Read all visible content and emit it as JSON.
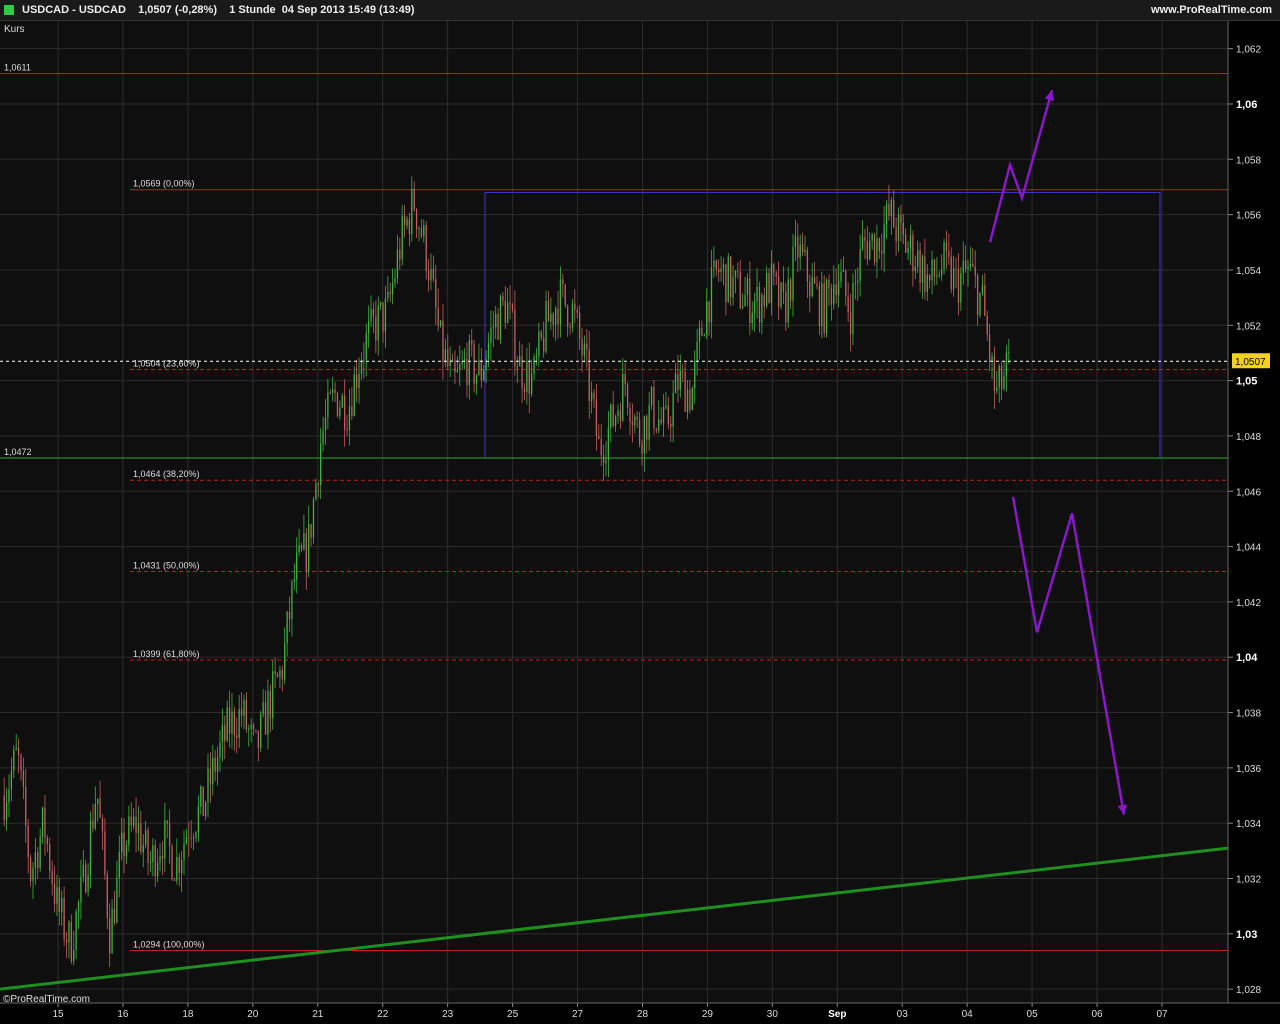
{
  "header": {
    "title": "USDCAD - USDCAD    1,0507 (-0,28%)    1 Stunde  04 Sep 2013 15:49 (13:49)",
    "brand": "www.ProRealTime.com"
  },
  "panel_label": "Kurs",
  "copyright": "©ProRealTime.com",
  "colors": {
    "background": "#0f0f0f",
    "grid": "#2c2c2c",
    "bull": "#3fb43f",
    "bear": "#c06060",
    "resistance": "#c81e1e",
    "fib": "#c81e1e",
    "support": "#2fa82f",
    "trend": "#1f8f1f",
    "box": "#3838c8",
    "arrows": "#8a17c8",
    "price_tag": "#f2d21c"
  },
  "chart_data": {
    "type": "candlestick",
    "instrument": "USDCAD",
    "ylim": [
      1.0275,
      1.063
    ],
    "yticks": [
      {
        "value": 1.028,
        "label": "1,028",
        "major": false
      },
      {
        "value": 1.03,
        "label": "1,03",
        "major": true
      },
      {
        "value": 1.032,
        "label": "1,032",
        "major": false
      },
      {
        "value": 1.034,
        "label": "1,034",
        "major": false
      },
      {
        "value": 1.036,
        "label": "1,036",
        "major": false
      },
      {
        "value": 1.038,
        "label": "1,038",
        "major": false
      },
      {
        "value": 1.04,
        "label": "1,04",
        "major": true
      },
      {
        "value": 1.042,
        "label": "1,042",
        "major": false
      },
      {
        "value": 1.044,
        "label": "1,044",
        "major": false
      },
      {
        "value": 1.046,
        "label": "1,046",
        "major": false
      },
      {
        "value": 1.048,
        "label": "1,048",
        "major": false
      },
      {
        "value": 1.05,
        "label": "1,05",
        "major": true
      },
      {
        "value": 1.052,
        "label": "1,052",
        "major": false
      },
      {
        "value": 1.054,
        "label": "1,054",
        "major": false
      },
      {
        "value": 1.056,
        "label": "1,056",
        "major": false
      },
      {
        "value": 1.058,
        "label": "1,058",
        "major": false
      },
      {
        "value": 1.06,
        "label": "1,06",
        "major": true
      },
      {
        "value": 1.062,
        "label": "1,062",
        "major": false
      }
    ],
    "xticks": [
      {
        "label": "15",
        "major": false
      },
      {
        "label": "16",
        "major": false
      },
      {
        "label": "18",
        "major": false
      },
      {
        "label": "20",
        "major": false
      },
      {
        "label": "21",
        "major": false
      },
      {
        "label": "22",
        "major": false
      },
      {
        "label": "23",
        "major": false
      },
      {
        "label": "25",
        "major": false
      },
      {
        "label": "27",
        "major": false
      },
      {
        "label": "28",
        "major": false
      },
      {
        "label": "29",
        "major": false
      },
      {
        "label": "30",
        "major": false
      },
      {
        "label": "Sep",
        "major": true
      },
      {
        "label": "03",
        "major": false
      },
      {
        "label": "04",
        "major": false
      },
      {
        "label": "05",
        "major": false
      },
      {
        "label": "06",
        "major": false
      },
      {
        "label": "07",
        "major": false
      }
    ],
    "close_path": [
      1.035,
      1.0365,
      1.0322,
      1.034,
      1.031,
      1.0296,
      1.0318,
      1.0353,
      1.03,
      1.0332,
      1.034,
      1.0325,
      1.0335,
      1.0325,
      1.034,
      1.0345,
      1.0362,
      1.0375,
      1.038,
      1.0365,
      1.0383,
      1.0395,
      1.043,
      1.044,
      1.048,
      1.0495,
      1.049,
      1.051,
      1.052,
      1.0525,
      1.055,
      1.0565,
      1.0545,
      1.0513,
      1.0498,
      1.0507,
      1.0502,
      1.052,
      1.0528,
      1.0505,
      1.05,
      1.052,
      1.053,
      1.0525,
      1.0505,
      1.0475,
      1.0485,
      1.05,
      1.048,
      1.049,
      1.0482,
      1.05,
      1.0495,
      1.0525,
      1.054,
      1.0535,
      1.053,
      1.0528,
      1.0535,
      1.0525,
      1.0548,
      1.0535,
      1.0525,
      1.054,
      1.0525,
      1.055,
      1.055,
      1.056,
      1.055,
      1.0545,
      1.0535,
      1.0542,
      1.0535,
      1.054,
      1.0528,
      1.0494,
      1.0505
    ],
    "levels": [
      {
        "value": 1.0611,
        "label": "1,0611",
        "style": "resistance"
      },
      {
        "value": 1.0569,
        "label": "1,0569 (0,00%)",
        "style": "resistance"
      },
      {
        "value": 1.0504,
        "label": "1,0504 (23,60%)",
        "style": "fib"
      },
      {
        "value": 1.0472,
        "label": "1,0472",
        "style": "support"
      },
      {
        "value": 1.0464,
        "label": "1,0464 (38,20%)",
        "style": "fib"
      },
      {
        "value": 1.0431,
        "label": "1,0431 (50,00%)",
        "style": "fib"
      },
      {
        "value": 1.0399,
        "label": "1,0399 (61,80%)",
        "style": "fib"
      },
      {
        "value": 1.0294,
        "label": "1,0294 (100,00%)",
        "style": "resistance"
      }
    ],
    "current_price": {
      "value": 1.0507,
      "label": "1,0507"
    },
    "consolidation_box": {
      "ymin": 1.0472,
      "ymax": 1.0568
    },
    "trendline": {
      "y_start": 1.028,
      "y_end": 1.0331
    },
    "scenarios": [
      {
        "name": "upside",
        "path": [
          1.055,
          1.0578,
          1.0566,
          1.0605
        ]
      },
      {
        "name": "downside",
        "path": [
          1.0458,
          1.0409,
          1.0452,
          1.0343
        ]
      }
    ]
  }
}
